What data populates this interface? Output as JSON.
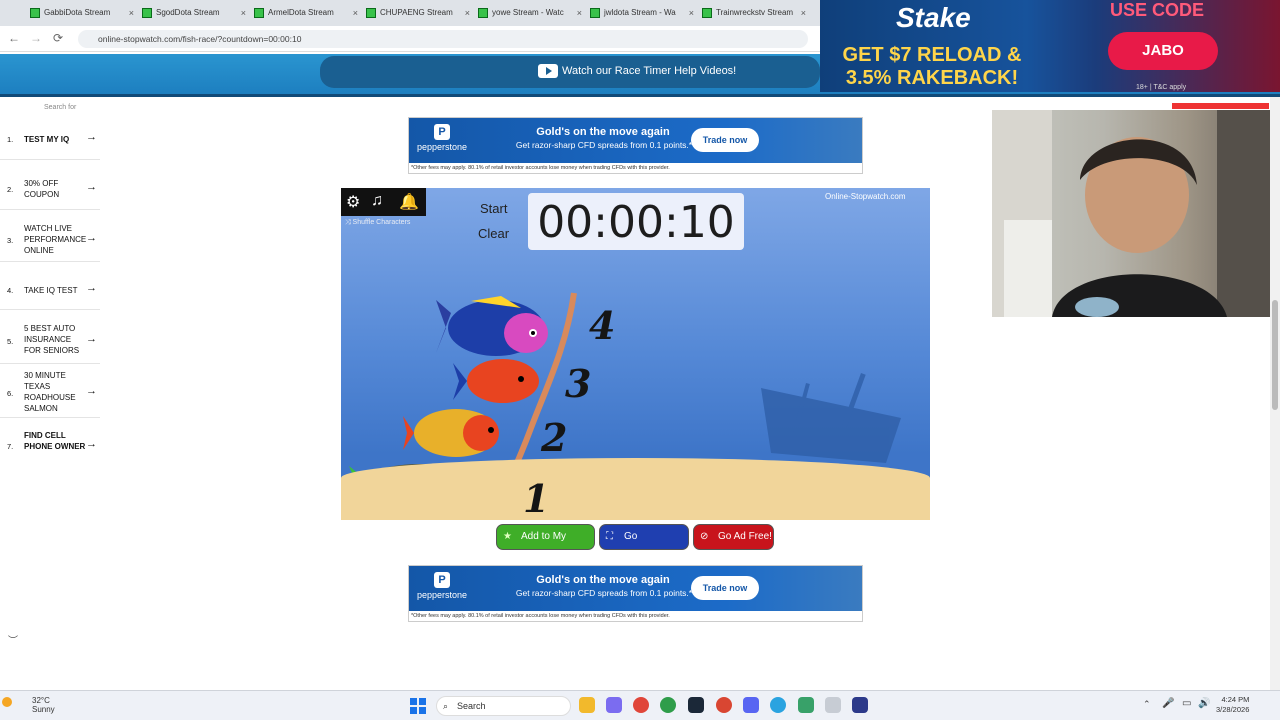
{
  "browser": {
    "tabs": [
      {
        "label": "GabbiDota Stream"
      },
      {
        "label": "SgodDota Stream"
      },
      {
        "label": "ArmelDota Stream"
      },
      {
        "label": "CHUPAENG Stream"
      },
      {
        "label": "yowe Stream - Watc"
      },
      {
        "label": "jwldota Stream - Wa"
      },
      {
        "label": "Trainwreckstv Stream"
      }
    ],
    "tab_close": "×",
    "back": "←",
    "forward": "→",
    "reload": "⟳",
    "url": "online-stopwatch.com/fish-race/?countdown=00:00:10"
  },
  "header": {
    "help_video_label": "Watch our Race Timer Help Videos!"
  },
  "stake_ad": {
    "logo": "Stake",
    "offer_line1": "GET $7 RELOAD &",
    "offer_line2": "3.5% RAKEBACK!",
    "use_code": "USE CODE",
    "code": "JABO",
    "legal": "18+ | T&C apply"
  },
  "sidebar": {
    "search_for": "Search for",
    "arrow": "→",
    "items": [
      {
        "num": "1.",
        "label": "TEST MY IQ"
      },
      {
        "num": "2.",
        "label": "30% OFF COUPON"
      },
      {
        "num": "3.",
        "label": "WATCH LIVE PERFORMANCE ONLINE"
      },
      {
        "num": "4.",
        "label": "TAKE IQ TEST"
      },
      {
        "num": "5.",
        "label": "5 BEST AUTO INSURANCE FOR SENIORS"
      },
      {
        "num": "6.",
        "label": "30 MINUTE TEXAS ROADHOUSE SALMON"
      },
      {
        "num": "7.",
        "label": "FIND CELL PHONE OWNER"
      }
    ]
  },
  "ads": {
    "brand": "pepperstone",
    "brand_mark": "P",
    "headline": "Gold's on the move again",
    "sub": "Get razor-sharp CFD spreads from 0.1 points.*",
    "cta": "Trade now",
    "fine": "*Other fees may apply. 80.1% of retail investor accounts lose money when trading CFDs with this provider."
  },
  "stopwatch": {
    "shuffle_label": "Shuffle Characters",
    "start_label": "Start",
    "clear_label": "Clear",
    "time": "00:00:10",
    "brand": "Online-Stopwatch.com",
    "lanes": [
      "4",
      "3",
      "2",
      "1"
    ]
  },
  "buttons": {
    "add": "Add to My Page!",
    "fullscreen": "Go Fullscreen!",
    "adfree": "Go Ad Free!"
  },
  "taskbar": {
    "temp": "32°C",
    "weather": "Sunny",
    "search": "Search",
    "time": "4:24 PM",
    "date": "3/28/2026"
  },
  "colors": {
    "header_blue": "#1d7fc0",
    "add_green": "#3fae28",
    "fullscreen_blue": "#1f3fb0",
    "adfree_red": "#c8141c"
  }
}
